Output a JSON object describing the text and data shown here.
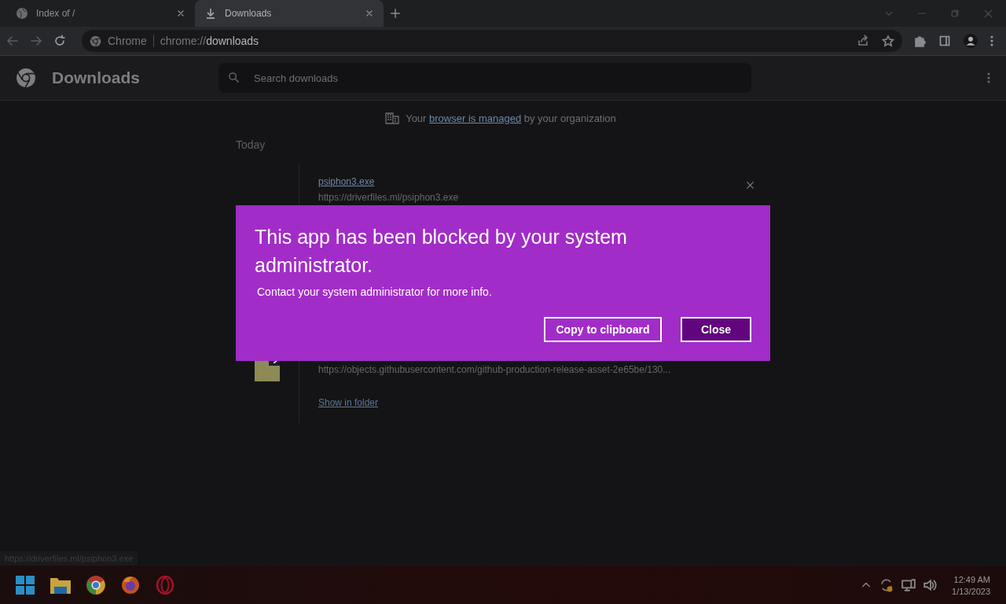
{
  "tabs": [
    {
      "title": "Index of /",
      "selected": false
    },
    {
      "title": "Downloads",
      "selected": true
    }
  ],
  "address_bar": {
    "origin": "Chrome",
    "url_prefix": "chrome://",
    "url_path": "downloads"
  },
  "page": {
    "title": "Downloads",
    "search": {
      "placeholder": "Search downloads"
    }
  },
  "managed_notice": {
    "before": "Your",
    "link": "browser is managed",
    "after": "by your organization"
  },
  "date_heading": "Today",
  "downloads": [
    {
      "file_name": "psiphon3.exe",
      "url": "https://driverfiles.ml/psiphon3.exe"
    },
    {
      "url": "https://objects.githubusercontent.com/github-production-release-asset-2e65be/130...",
      "action": "Show in folder"
    }
  ],
  "dialog": {
    "title": "This app has been blocked by your system administrator.",
    "message": "Contact your system administrator for more info.",
    "buttons": [
      {
        "label": "Copy to clipboard",
        "kind": "secondary"
      },
      {
        "label": "Close",
        "kind": "primary"
      }
    ]
  },
  "status_url": "https://driverfiles.ml/psiphon3.exe",
  "taskbar": {
    "time": "12:49 AM",
    "date": "1/13/2023"
  }
}
